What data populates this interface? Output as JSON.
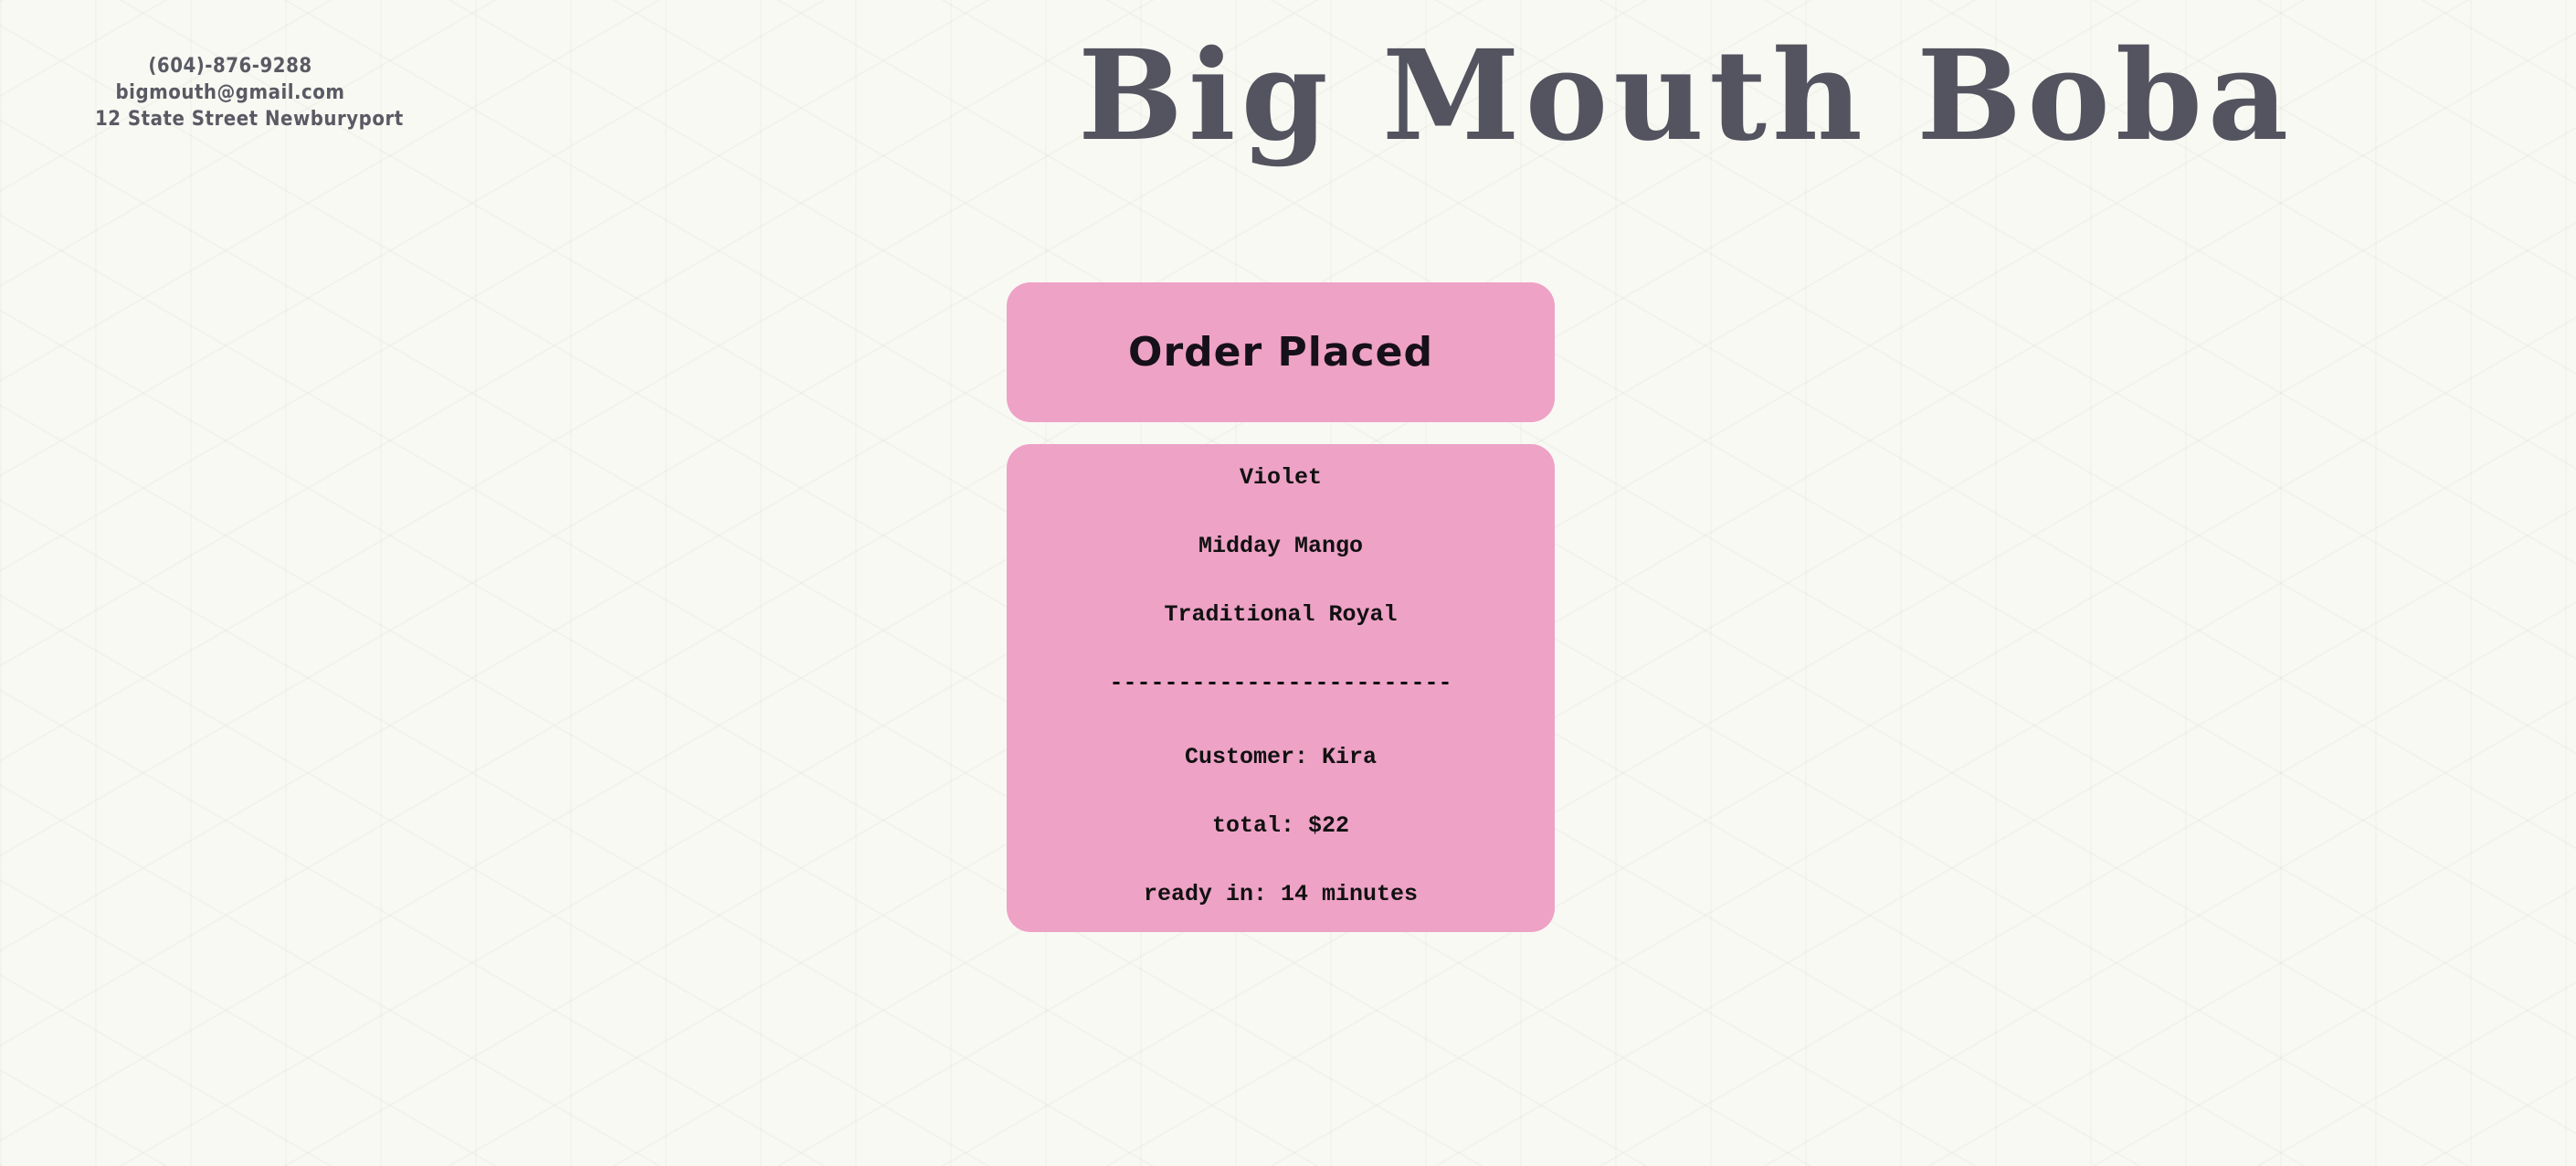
{
  "contact": {
    "phone": "(604)-876-9288",
    "email": "bigmouth@gmail.com",
    "address": "12 State Street Newburyport"
  },
  "brand": {
    "title": "Big Mouth Boba"
  },
  "order": {
    "status_title": "Order Placed",
    "items": [
      "Violet",
      "Midday Mango",
      "Traditional Royal"
    ],
    "divider": "-------------------------",
    "customer": "Customer: Kira",
    "total": "total: $22",
    "ready": "ready in: 14 minutes"
  },
  "colors": {
    "background": "#f9f9f4",
    "card": "#eea2c6",
    "brand_text": "#545460",
    "card_text": "#111111"
  }
}
